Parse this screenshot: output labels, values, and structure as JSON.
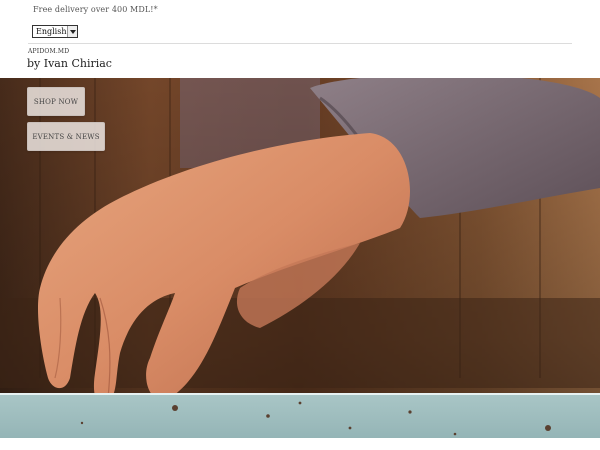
{
  "header": {
    "promo_text": "Free delivery over 400 MDL!*",
    "language": {
      "selected": "English"
    },
    "brand_small": "APIDOM.MD",
    "brand_name": "by Ivan Chiriac"
  },
  "hero": {
    "buttons": {
      "shop_now": "SHOP NOW",
      "events_news": "EVENTS & NEWS"
    }
  }
}
